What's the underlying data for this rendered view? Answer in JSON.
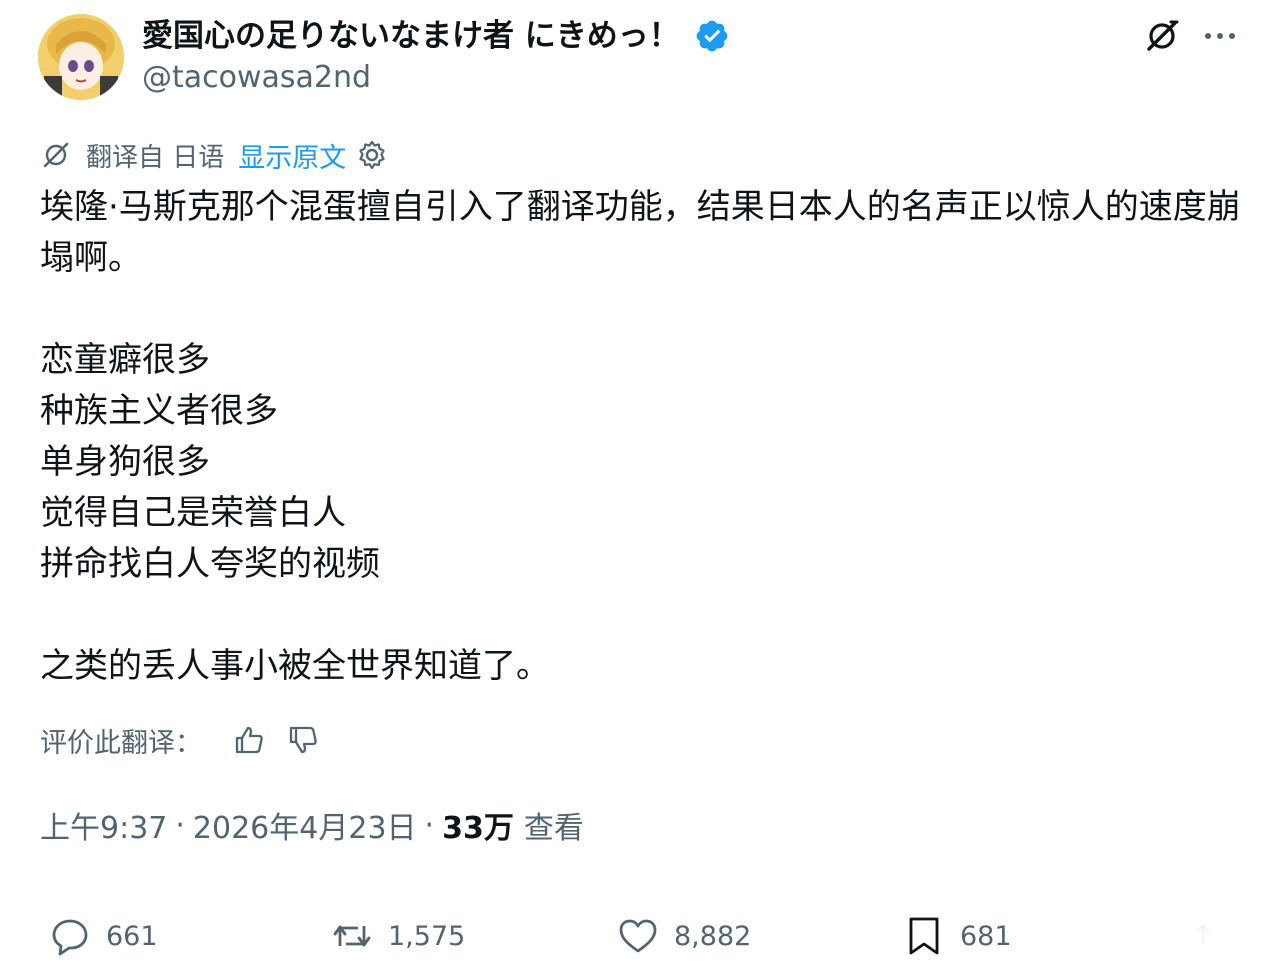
{
  "author": {
    "display_name": "愛国心の足りないなまけ者 にきめっ！",
    "handle": "@tacowasa2nd",
    "verified": true
  },
  "header_icons": {
    "grok": "grok-icon",
    "more": "more-icon"
  },
  "translation": {
    "from_label": "翻译自 日语",
    "show_original": "显示原文"
  },
  "post": {
    "intro": "埃隆·马斯克那个混蛋擅自引入了翻译功能，结果日本人的名声正以惊人的速度崩塌啊。",
    "list": [
      "恋童癖很多",
      "种族主义者很多",
      "单身狗很多",
      "觉得自己是荣誉白人",
      "拼命找白人夸奖的视频"
    ],
    "outro": "之类的丢人事小被全世界知道了。"
  },
  "rate": {
    "label": "评价此翻译："
  },
  "meta": {
    "time": "上午9:37",
    "date": "2026年4月23日",
    "views_count": "33万",
    "views_label": "查看"
  },
  "actions": {
    "replies": "661",
    "reposts": "1,575",
    "likes": "8,882",
    "bookmarks": "681"
  },
  "colors": {
    "accent": "#1d9bf0",
    "text_primary": "#0f1419",
    "text_secondary": "#536471"
  }
}
